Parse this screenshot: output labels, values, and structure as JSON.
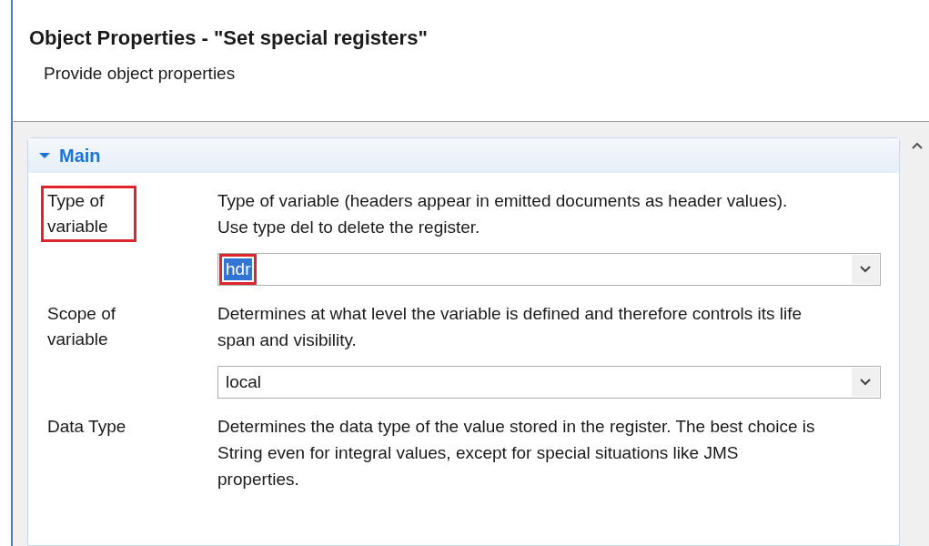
{
  "header": {
    "title": "Object Properties - \"Set special registers\"",
    "subtitle": "Provide object properties"
  },
  "section": {
    "title": "Main",
    "expanded": true
  },
  "properties": [
    {
      "label": "Type of variable",
      "label_highlighted": true,
      "description": "Type of variable (headers appear in emitted documents as header values). Use type del to delete the register.",
      "value": "hdr",
      "value_selected": true,
      "value_highlighted": true
    },
    {
      "label": "Scope of variable",
      "label_highlighted": false,
      "description": "Determines at what level the variable is defined and therefore controls its life span and visibility.",
      "value": "local",
      "value_selected": false,
      "value_highlighted": false
    },
    {
      "label": "Data Type",
      "label_highlighted": false,
      "description": "Determines the data type of the value stored in the register. The best choice is String even for integral values, except for special situations like JMS properties."
    }
  ]
}
